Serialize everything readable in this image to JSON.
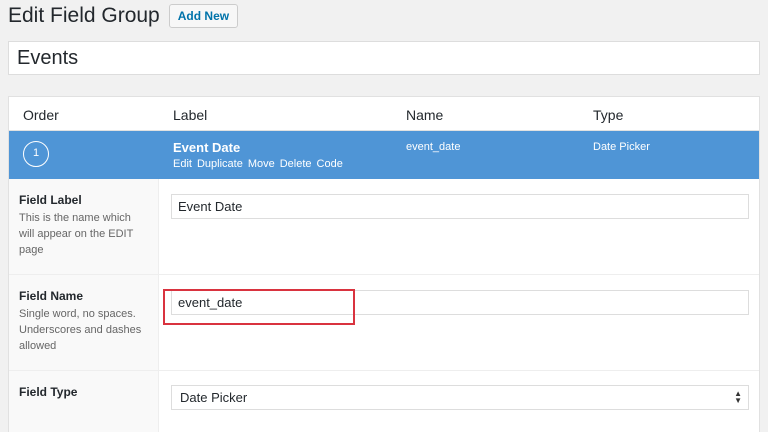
{
  "header": {
    "title": "Edit Field Group",
    "add_new_label": "Add New"
  },
  "group_title": "Events",
  "table": {
    "columns": [
      "Order",
      "Label",
      "Name",
      "Type"
    ]
  },
  "field": {
    "order": "1",
    "label": "Event Date",
    "name": "event_date",
    "type": "Date Picker",
    "actions": [
      "Edit",
      "Duplicate",
      "Move",
      "Delete",
      "Code"
    ]
  },
  "settings": {
    "field_label": {
      "title": "Field Label",
      "description": "This is the name which will appear on the EDIT page",
      "value": "Event Date"
    },
    "field_name": {
      "title": "Field Name",
      "description": "Single word, no spaces. Underscores and dashes allowed",
      "value": "event_date"
    },
    "field_type": {
      "title": "Field Type",
      "value": "Date Picker"
    }
  },
  "colors": {
    "accent": "#4f95d6",
    "highlight": "#d9333f",
    "link": "#0073aa"
  }
}
